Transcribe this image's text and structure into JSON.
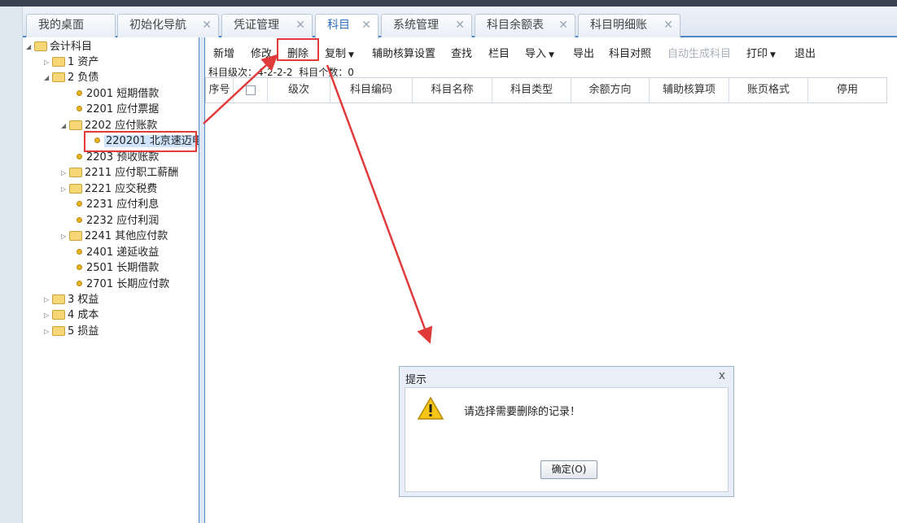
{
  "tabs": [
    {
      "label": "我的桌面",
      "closable": false,
      "active": false
    },
    {
      "label": "初始化导航",
      "closable": true,
      "active": false
    },
    {
      "label": "凭证管理",
      "closable": true,
      "active": false
    },
    {
      "label": "科目",
      "closable": true,
      "active": true
    },
    {
      "label": "系统管理",
      "closable": true,
      "active": false
    },
    {
      "label": "科目余额表",
      "closable": true,
      "active": false
    },
    {
      "label": "科目明细账",
      "closable": true,
      "active": false
    }
  ],
  "tree": {
    "root": "会计科目",
    "items": [
      {
        "code": "1",
        "name": "资产"
      },
      {
        "code": "2",
        "name": "负债"
      },
      {
        "code": "2001",
        "name": "短期借款"
      },
      {
        "code": "2201",
        "name": "应付票据"
      },
      {
        "code": "2202",
        "name": "应付账款"
      },
      {
        "code": "220201",
        "name": "北京速迈电"
      },
      {
        "code": "2203",
        "name": "预收账款"
      },
      {
        "code": "2211",
        "name": "应付职工薪酬"
      },
      {
        "code": "2221",
        "name": "应交税费"
      },
      {
        "code": "2231",
        "name": "应付利息"
      },
      {
        "code": "2232",
        "name": "应付利润"
      },
      {
        "code": "2241",
        "name": "其他应付款"
      },
      {
        "code": "2401",
        "name": "递延收益"
      },
      {
        "code": "2501",
        "name": "长期借款"
      },
      {
        "code": "2701",
        "name": "长期应付款"
      },
      {
        "code": "3",
        "name": "权益"
      },
      {
        "code": "4",
        "name": "成本"
      },
      {
        "code": "5",
        "name": "损益"
      }
    ]
  },
  "toolbar": {
    "add": "新增",
    "edit": "修改",
    "delete": "删除",
    "copy": "复制",
    "aux_setting": "辅助核算设置",
    "find": "查找",
    "columns": "栏目",
    "import": "导入",
    "export": "导出",
    "compare": "科目对照",
    "auto_gen": "自动生成科目",
    "print": "打印",
    "exit": "退出"
  },
  "info": {
    "level_label": "科目级次：",
    "level_value": "4-2-2-2",
    "count_label": "科目个数：",
    "count_value": "0"
  },
  "columns": [
    "序号",
    "级次",
    "科目编码",
    "科目名称",
    "科目类型",
    "余额方向",
    "辅助核算项",
    "账页格式",
    "停用"
  ],
  "dialog": {
    "title": "提示",
    "message": "请选择需要删除的记录！",
    "ok": "确定(O)",
    "close": "x"
  },
  "colors": {
    "accent": "#4a86c8",
    "highlight": "#e03a3a",
    "selection": "#cfe3fa"
  }
}
